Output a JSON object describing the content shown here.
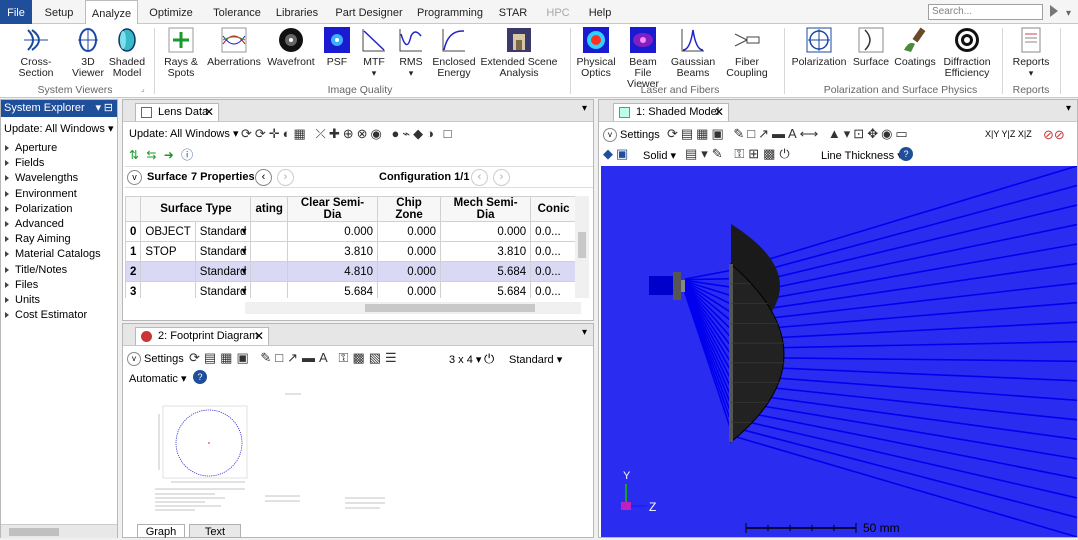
{
  "menu": {
    "items": [
      "File",
      "Setup",
      "Analyze",
      "Optimize",
      "Tolerance",
      "Libraries",
      "Part Designer",
      "Programming",
      "STAR",
      "HPC",
      "Help"
    ],
    "search_placeholder": "Search..."
  },
  "ribbon": {
    "buttons": [
      {
        "label": "Cross-Section",
        "icon": "cross-section-icon"
      },
      {
        "label": "3D Viewer",
        "icon": "3d-viewer-icon"
      },
      {
        "label": "Shaded Model",
        "icon": "shaded-model-icon"
      },
      {
        "label": "Rays & Spots",
        "icon": "rays-spots-icon"
      },
      {
        "label": "Aberrations",
        "icon": "aberrations-icon"
      },
      {
        "label": "Wavefront",
        "icon": "wavefront-icon"
      },
      {
        "label": "PSF",
        "icon": "psf-icon"
      },
      {
        "label": "MTF",
        "icon": "mtf-icon"
      },
      {
        "label": "RMS",
        "icon": "rms-icon"
      },
      {
        "label": "Enclosed Energy",
        "icon": "enclosed-energy-icon"
      },
      {
        "label": "Extended Scene Analysis",
        "icon": "extended-scene-icon"
      },
      {
        "label": "Physical Optics",
        "icon": "physical-optics-icon"
      },
      {
        "label": "Beam File Viewer",
        "icon": "beam-file-icon"
      },
      {
        "label": "Gaussian Beams",
        "icon": "gaussian-beams-icon"
      },
      {
        "label": "Fiber Coupling",
        "icon": "fiber-coupling-icon"
      },
      {
        "label": "Polarization",
        "icon": "polarization-icon"
      },
      {
        "label": "Surface",
        "icon": "surface-icon"
      },
      {
        "label": "Coatings",
        "icon": "coatings-icon"
      },
      {
        "label": "Diffraction Efficiency",
        "icon": "diffraction-efficiency-icon"
      },
      {
        "label": "Reports",
        "icon": "reports-icon"
      }
    ],
    "groups": [
      "System Viewers",
      "Image Quality",
      "Laser and Fibers",
      "Polarization and Surface Physics",
      "Reports"
    ]
  },
  "system_explorer": {
    "title": "System Explorer",
    "update": "Update: All Windows",
    "items": [
      "Aperture",
      "Fields",
      "Wavelengths",
      "Environment",
      "Polarization",
      "Advanced",
      "Ray Aiming",
      "Material Catalogs",
      "Title/Notes",
      "Files",
      "Units",
      "Cost Estimator"
    ]
  },
  "lens_data": {
    "tab": "Lens Data",
    "update": "Update: All Windows",
    "surface_label": "Surface",
    "properties_label": "7 Properties",
    "config_label": "Configuration 1/1",
    "columns": [
      "Surface Type",
      "ating",
      "Clear Semi-Dia",
      "Chip Zone",
      "Mech Semi-Dia",
      "Conic"
    ],
    "rows": [
      {
        "num": "0",
        "name": "OBJECT",
        "type": "Standard",
        "clear": "0.000",
        "chip": "0.000",
        "mech": "0.000",
        "conic": "0.0..."
      },
      {
        "num": "1",
        "name": "STOP",
        "type": "Standard",
        "clear": "3.810",
        "chip": "0.000",
        "mech": "3.810",
        "conic": "0.0..."
      },
      {
        "num": "2",
        "name": "",
        "type": "Standard",
        "clear": "4.810",
        "chip": "0.000",
        "mech": "5.684",
        "conic": "0.0..."
      },
      {
        "num": "3",
        "name": "",
        "type": "Standard",
        "clear": "5.684",
        "chip": "0.000",
        "mech": "5.684",
        "conic": "0.0..."
      }
    ]
  },
  "footprint": {
    "tab": "2: Footprint Diagram",
    "settings": "Settings",
    "grid": "3 x 4",
    "standard": "Standard",
    "automatic": "Automatic",
    "bottom_tabs": [
      "Graph",
      "Text"
    ]
  },
  "shaded": {
    "tab": "1: Shaded Model",
    "settings": "Settings",
    "solid": "Solid",
    "line_thickness": "Line Thickness",
    "scale_label": "50 mm",
    "axis_y": "Y",
    "axis_z": "Z",
    "toolbar_axes": [
      "X|Y",
      "Y|Z",
      "X|Z"
    ]
  },
  "colors": {
    "file_menu": "#1f4e9a",
    "viewport": "#2a2cf0",
    "rays": "#0000ee",
    "selected_row": "#d9d9f5"
  }
}
